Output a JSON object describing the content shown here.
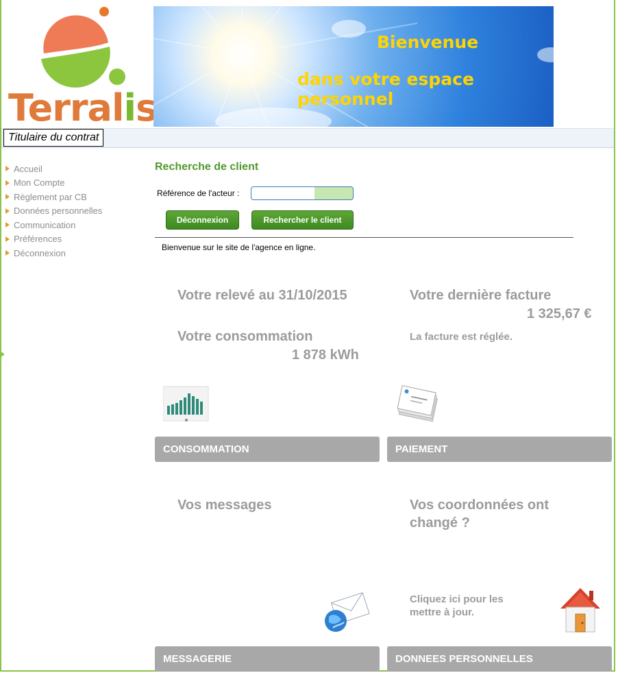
{
  "logo": {
    "text_part1": "Terral",
    "text_part2": "i",
    "text_part3": "s"
  },
  "banner": {
    "line1": "Bienvenue",
    "line2": "dans votre espace personnel"
  },
  "strip": {
    "label": "Titulaire du contrat"
  },
  "sidebar": {
    "items": [
      {
        "label": "Accueil"
      },
      {
        "label": "Mon Compte"
      },
      {
        "label": "Règlement par CB"
      },
      {
        "label": "Données personnelles"
      },
      {
        "label": "Communication"
      },
      {
        "label": "Préférences"
      },
      {
        "label": "Déconnexion"
      }
    ]
  },
  "search": {
    "title": "Recherche de client",
    "ref_label": "Référence de l'acteur :",
    "ref_value": "",
    "logout_label": "Déconnexion",
    "search_label": "Rechercher le client"
  },
  "welcome": "Bienvenue sur le site de l'agence en ligne.",
  "releve": {
    "title": "Votre relevé au 31/10/2015"
  },
  "consommation": {
    "title": "Votre consommation",
    "value": "1 878 kWh"
  },
  "facture": {
    "title": "Votre dernière facture",
    "amount": "1 325,67 €",
    "status": "La facture est réglée."
  },
  "messages": {
    "title": "Vos messages"
  },
  "coordonnees": {
    "title_line1": "Vos coordonnées ont",
    "title_line2": "changé ?",
    "cta_line1": "Cliquez ici pour les",
    "cta_line2": "mettre à jour."
  },
  "tiles": {
    "consommation": "CONSOMMATION",
    "paiement": "PAIEMENT",
    "messagerie": "MESSAGERIE",
    "donnees": "DONNEES PERSONNELLES"
  },
  "icons": {
    "chart": "bar-chart-icon",
    "invoice": "invoice-icon",
    "mail": "mail-globe-icon",
    "house": "house-icon"
  },
  "colors": {
    "accent_green": "#4f9a2a",
    "button_green": "#4a9a2c",
    "tile_gray": "#a8a8a8",
    "info_gray": "#9b9b9b",
    "logo_orange": "#e07a3a",
    "logo_green": "#7cb82f",
    "banner_text": "#ffd400"
  }
}
